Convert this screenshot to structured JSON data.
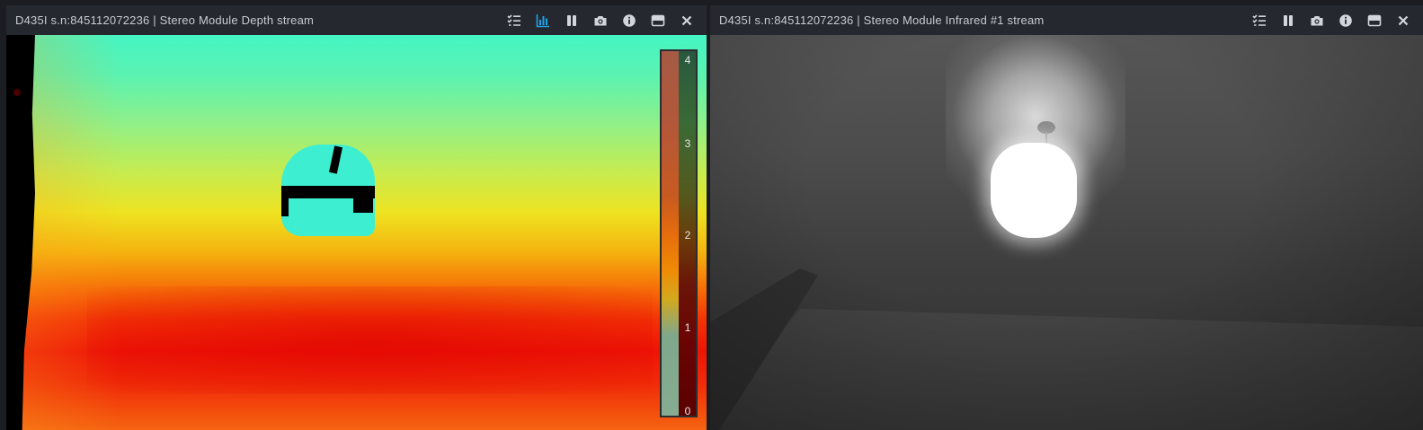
{
  "depth_window": {
    "title": "D435I s.n:845112072236 | Stereo Module Depth stream",
    "toolbar": [
      {
        "name": "controls-icon",
        "active": false
      },
      {
        "name": "metrics-icon",
        "active": true
      },
      {
        "name": "pause-icon",
        "active": false
      },
      {
        "name": "camera-icon",
        "active": false
      },
      {
        "name": "info-icon",
        "active": false
      },
      {
        "name": "maximize-icon",
        "active": false
      },
      {
        "name": "close-icon",
        "active": false
      }
    ],
    "colorbar_ticks": [
      "4",
      "3",
      "2",
      "1",
      "0"
    ]
  },
  "ir_window": {
    "title": "D435I s.n:845112072236 | Stereo Module Infrared #1 stream",
    "toolbar": [
      {
        "name": "controls-icon",
        "active": false
      },
      {
        "name": "pause-icon",
        "active": false
      },
      {
        "name": "camera-icon",
        "active": false
      },
      {
        "name": "info-icon",
        "active": false
      },
      {
        "name": "maximize-icon",
        "active": false
      },
      {
        "name": "close-icon",
        "active": false
      }
    ]
  },
  "colors": {
    "icon_default": "#d2d6dc",
    "icon_active": "#1fa2e9",
    "titlebar": "#25282e"
  }
}
